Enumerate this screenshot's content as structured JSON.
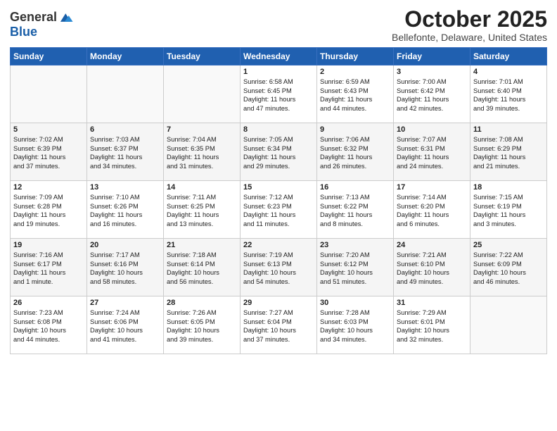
{
  "header": {
    "logo_line1": "General",
    "logo_line2": "Blue",
    "month": "October 2025",
    "location": "Bellefonte, Delaware, United States"
  },
  "weekdays": [
    "Sunday",
    "Monday",
    "Tuesday",
    "Wednesday",
    "Thursday",
    "Friday",
    "Saturday"
  ],
  "rows": [
    [
      {
        "day": "",
        "info": ""
      },
      {
        "day": "",
        "info": ""
      },
      {
        "day": "",
        "info": ""
      },
      {
        "day": "1",
        "info": "Sunrise: 6:58 AM\nSunset: 6:45 PM\nDaylight: 11 hours\nand 47 minutes."
      },
      {
        "day": "2",
        "info": "Sunrise: 6:59 AM\nSunset: 6:43 PM\nDaylight: 11 hours\nand 44 minutes."
      },
      {
        "day": "3",
        "info": "Sunrise: 7:00 AM\nSunset: 6:42 PM\nDaylight: 11 hours\nand 42 minutes."
      },
      {
        "day": "4",
        "info": "Sunrise: 7:01 AM\nSunset: 6:40 PM\nDaylight: 11 hours\nand 39 minutes."
      }
    ],
    [
      {
        "day": "5",
        "info": "Sunrise: 7:02 AM\nSunset: 6:39 PM\nDaylight: 11 hours\nand 37 minutes."
      },
      {
        "day": "6",
        "info": "Sunrise: 7:03 AM\nSunset: 6:37 PM\nDaylight: 11 hours\nand 34 minutes."
      },
      {
        "day": "7",
        "info": "Sunrise: 7:04 AM\nSunset: 6:35 PM\nDaylight: 11 hours\nand 31 minutes."
      },
      {
        "day": "8",
        "info": "Sunrise: 7:05 AM\nSunset: 6:34 PM\nDaylight: 11 hours\nand 29 minutes."
      },
      {
        "day": "9",
        "info": "Sunrise: 7:06 AM\nSunset: 6:32 PM\nDaylight: 11 hours\nand 26 minutes."
      },
      {
        "day": "10",
        "info": "Sunrise: 7:07 AM\nSunset: 6:31 PM\nDaylight: 11 hours\nand 24 minutes."
      },
      {
        "day": "11",
        "info": "Sunrise: 7:08 AM\nSunset: 6:29 PM\nDaylight: 11 hours\nand 21 minutes."
      }
    ],
    [
      {
        "day": "12",
        "info": "Sunrise: 7:09 AM\nSunset: 6:28 PM\nDaylight: 11 hours\nand 19 minutes."
      },
      {
        "day": "13",
        "info": "Sunrise: 7:10 AM\nSunset: 6:26 PM\nDaylight: 11 hours\nand 16 minutes."
      },
      {
        "day": "14",
        "info": "Sunrise: 7:11 AM\nSunset: 6:25 PM\nDaylight: 11 hours\nand 13 minutes."
      },
      {
        "day": "15",
        "info": "Sunrise: 7:12 AM\nSunset: 6:23 PM\nDaylight: 11 hours\nand 11 minutes."
      },
      {
        "day": "16",
        "info": "Sunrise: 7:13 AM\nSunset: 6:22 PM\nDaylight: 11 hours\nand 8 minutes."
      },
      {
        "day": "17",
        "info": "Sunrise: 7:14 AM\nSunset: 6:20 PM\nDaylight: 11 hours\nand 6 minutes."
      },
      {
        "day": "18",
        "info": "Sunrise: 7:15 AM\nSunset: 6:19 PM\nDaylight: 11 hours\nand 3 minutes."
      }
    ],
    [
      {
        "day": "19",
        "info": "Sunrise: 7:16 AM\nSunset: 6:17 PM\nDaylight: 11 hours\nand 1 minute."
      },
      {
        "day": "20",
        "info": "Sunrise: 7:17 AM\nSunset: 6:16 PM\nDaylight: 10 hours\nand 58 minutes."
      },
      {
        "day": "21",
        "info": "Sunrise: 7:18 AM\nSunset: 6:14 PM\nDaylight: 10 hours\nand 56 minutes."
      },
      {
        "day": "22",
        "info": "Sunrise: 7:19 AM\nSunset: 6:13 PM\nDaylight: 10 hours\nand 54 minutes."
      },
      {
        "day": "23",
        "info": "Sunrise: 7:20 AM\nSunset: 6:12 PM\nDaylight: 10 hours\nand 51 minutes."
      },
      {
        "day": "24",
        "info": "Sunrise: 7:21 AM\nSunset: 6:10 PM\nDaylight: 10 hours\nand 49 minutes."
      },
      {
        "day": "25",
        "info": "Sunrise: 7:22 AM\nSunset: 6:09 PM\nDaylight: 10 hours\nand 46 minutes."
      }
    ],
    [
      {
        "day": "26",
        "info": "Sunrise: 7:23 AM\nSunset: 6:08 PM\nDaylight: 10 hours\nand 44 minutes."
      },
      {
        "day": "27",
        "info": "Sunrise: 7:24 AM\nSunset: 6:06 PM\nDaylight: 10 hours\nand 41 minutes."
      },
      {
        "day": "28",
        "info": "Sunrise: 7:26 AM\nSunset: 6:05 PM\nDaylight: 10 hours\nand 39 minutes."
      },
      {
        "day": "29",
        "info": "Sunrise: 7:27 AM\nSunset: 6:04 PM\nDaylight: 10 hours\nand 37 minutes."
      },
      {
        "day": "30",
        "info": "Sunrise: 7:28 AM\nSunset: 6:03 PM\nDaylight: 10 hours\nand 34 minutes."
      },
      {
        "day": "31",
        "info": "Sunrise: 7:29 AM\nSunset: 6:01 PM\nDaylight: 10 hours\nand 32 minutes."
      },
      {
        "day": "",
        "info": ""
      }
    ]
  ]
}
